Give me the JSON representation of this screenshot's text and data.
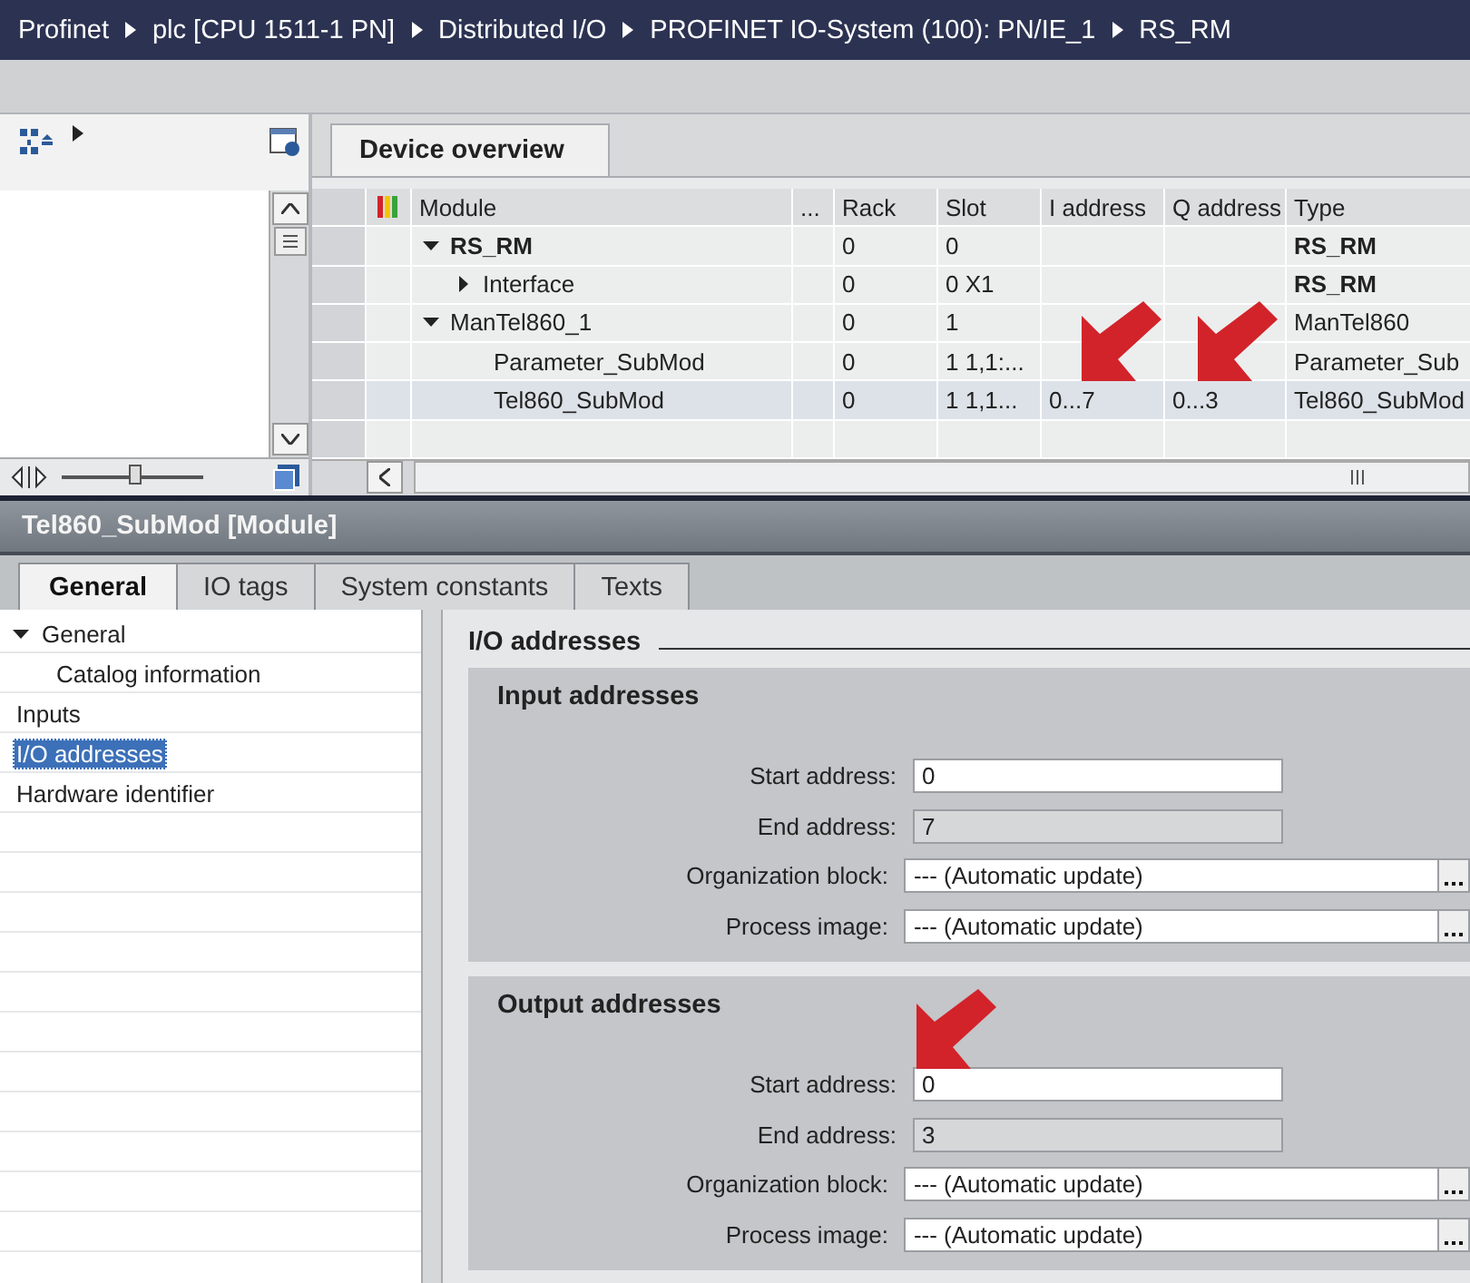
{
  "breadcrumb": [
    "Profinet",
    "plc [CPU 1511-1 PN]",
    "Distributed I/O",
    "PROFINET IO-System (100): PN/IE_1",
    "RS_RM"
  ],
  "left_pane": {
    "zoom_slider": {
      "level": 0.53
    }
  },
  "device_overview": {
    "tab": {
      "label": "Device overview",
      "selected": true
    },
    "columns": [
      "Module",
      "...",
      "Rack",
      "Slot",
      "I address",
      "Q address",
      "Type"
    ],
    "rows": [
      {
        "kind": "device",
        "module": "RS_RM",
        "rack": "0",
        "slot": "0",
        "type": "RS_RM",
        "expanded": true,
        "selected": false,
        "children": [
          {
            "kind": "interface",
            "module": "Interface",
            "rack": "0",
            "slot": "0 X1",
            "type": "RS_RM",
            "expanded": false,
            "selected": false
          }
        ]
      },
      {
        "kind": "module",
        "module": "ManTel860_1",
        "rack": "0",
        "slot": "1",
        "type": "ManTel860",
        "expanded": true,
        "selected": false,
        "children": [
          {
            "kind": "submodule",
            "module": "Parameter_SubMod",
            "rack": "0",
            "slot": "1 1,1:...",
            "type": "Parameter_Sub",
            "selected": false
          },
          {
            "kind": "submodule",
            "module": "Tel860_SubMod",
            "rack": "0",
            "slot": "1 1,1...",
            "i_address": "0...7",
            "q_address": "0...3",
            "type": "Tel860_SubMod",
            "selected": true
          }
        ]
      }
    ]
  },
  "properties": {
    "title": "Tel860_SubMod [Module]",
    "tabs": [
      {
        "label": "General",
        "selected": true
      },
      {
        "label": "IO tags",
        "selected": false
      },
      {
        "label": "System constants",
        "selected": false
      },
      {
        "label": "Texts",
        "selected": false
      }
    ],
    "nav": [
      {
        "label": "General",
        "expanded": true,
        "selected": false,
        "children": [
          {
            "label": "Catalog information",
            "selected": false
          }
        ]
      },
      {
        "label": "Inputs",
        "selected": false
      },
      {
        "label": "I/O addresses",
        "selected": true
      },
      {
        "label": "Hardware identifier",
        "selected": false
      }
    ],
    "section_title": "I/O addresses",
    "groups": [
      {
        "title": "Input addresses",
        "fields": [
          {
            "kind": "input",
            "label": "Start address:",
            "value": "0"
          },
          {
            "kind": "readonly",
            "label": "End address:",
            "value": "7"
          },
          {
            "kind": "select",
            "label": "Organization block:",
            "value": "--- (Automatic update)"
          },
          {
            "kind": "select",
            "label": "Process image:",
            "value": "--- (Automatic update)"
          }
        ]
      },
      {
        "title": "Output addresses",
        "fields": [
          {
            "kind": "input",
            "label": "Start address:",
            "value": "0"
          },
          {
            "kind": "readonly",
            "label": "End address:",
            "value": "3"
          },
          {
            "kind": "select",
            "label": "Organization block:",
            "value": "--- (Automatic update)"
          },
          {
            "kind": "select",
            "label": "Process image:",
            "value": "--- (Automatic update)"
          }
        ]
      }
    ]
  }
}
